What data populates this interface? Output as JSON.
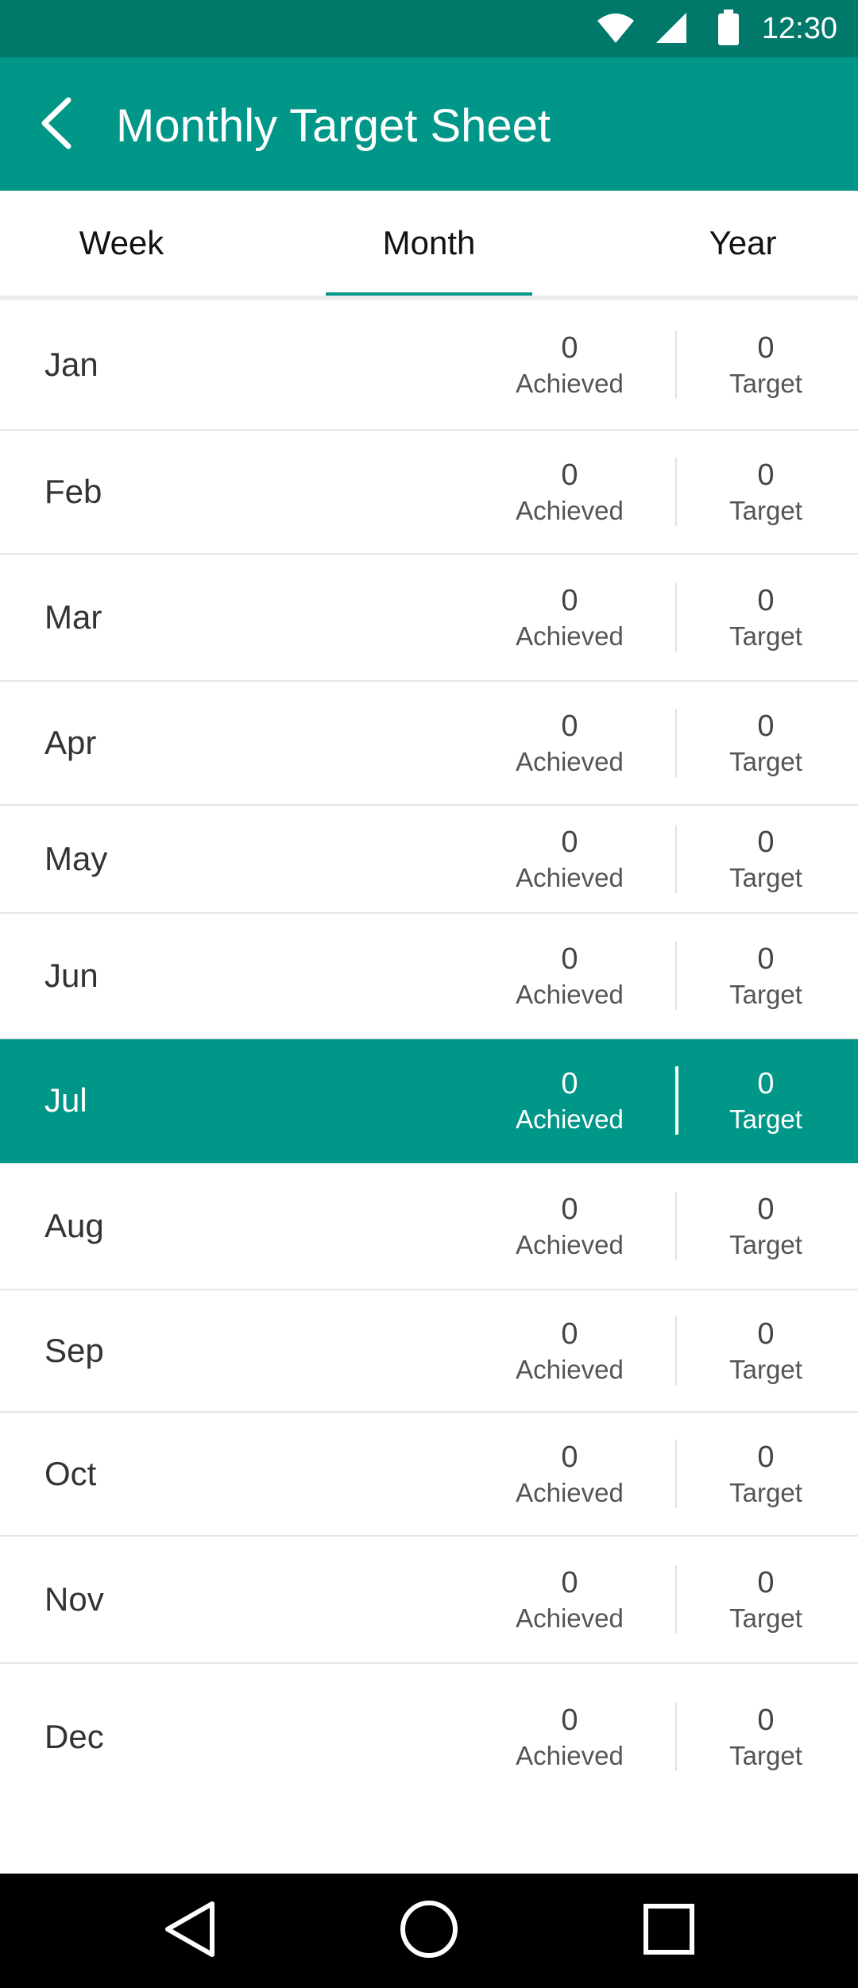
{
  "status_bar": {
    "time": "12:30",
    "icons": [
      "wifi-icon",
      "cell-signal-icon",
      "battery-icon"
    ]
  },
  "app_bar": {
    "title": "Monthly Target Sheet",
    "back_icon": "back-arrow-icon"
  },
  "tabs": [
    {
      "label": "Week",
      "selected": false
    },
    {
      "label": "Month",
      "selected": true
    },
    {
      "label": "Year",
      "selected": false
    }
  ],
  "labels": {
    "achieved": "Achieved",
    "target": "Target"
  },
  "months": [
    {
      "name": "Jan",
      "achieved": "0",
      "target": "0",
      "selected": false
    },
    {
      "name": "Feb",
      "achieved": "0",
      "target": "0",
      "selected": false
    },
    {
      "name": "Mar",
      "achieved": "0",
      "target": "0",
      "selected": false
    },
    {
      "name": "Apr",
      "achieved": "0",
      "target": "0",
      "selected": false
    },
    {
      "name": "May",
      "achieved": "0",
      "target": "0",
      "selected": false
    },
    {
      "name": "Jun",
      "achieved": "0",
      "target": "0",
      "selected": false
    },
    {
      "name": "Jul",
      "achieved": "0",
      "target": "0",
      "selected": true
    },
    {
      "name": "Aug",
      "achieved": "0",
      "target": "0",
      "selected": false
    },
    {
      "name": "Sep",
      "achieved": "0",
      "target": "0",
      "selected": false
    },
    {
      "name": "Oct",
      "achieved": "0",
      "target": "0",
      "selected": false
    },
    {
      "name": "Nov",
      "achieved": "0",
      "target": "0",
      "selected": false
    },
    {
      "name": "Dec",
      "achieved": "0",
      "target": "0",
      "selected": false
    }
  ],
  "colors": {
    "primary": "#009688",
    "primary_dark": "#00796b",
    "divider": "#e6e6e6"
  },
  "nav_bar": {
    "icons": [
      "back-triangle-icon",
      "home-circle-icon",
      "recents-square-icon"
    ]
  }
}
